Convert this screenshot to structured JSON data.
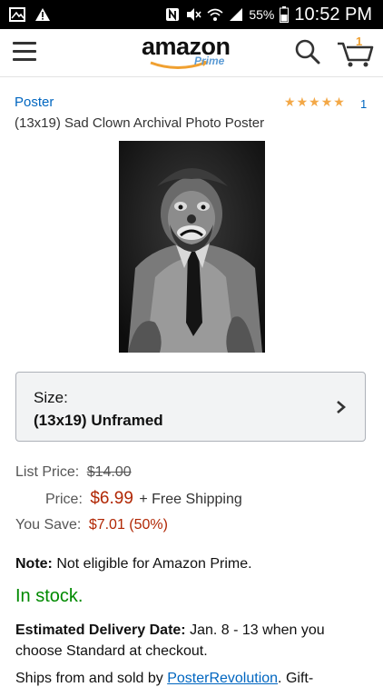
{
  "status_bar": {
    "battery": "55%",
    "time": "10:52 PM"
  },
  "header": {
    "logo_text": "amazon",
    "logo_sub": "Prime",
    "cart_count": "1"
  },
  "product": {
    "brand": "Poster",
    "rating_stars": 5,
    "review_count": "1",
    "title": "(13x19) Sad Clown Archival Photo Poster"
  },
  "size_selector": {
    "label": "Size:",
    "value": "(13x19) Unframed"
  },
  "pricing": {
    "list_price_label": "List Price:",
    "list_price_value": "$14.00",
    "price_label": "Price:",
    "price_value": "$6.99",
    "shipping_text": "+ Free Shipping",
    "you_save_label": "You Save:",
    "you_save_value": "$7.01 (50%)"
  },
  "note": {
    "label": "Note:",
    "text": " Not eligible for Amazon Prime."
  },
  "stock_status": "In stock.",
  "delivery": {
    "label": "Estimated Delivery Date:",
    "text": " Jan. 8 - 13 when you choose Standard at checkout."
  },
  "ships_from": {
    "prefix": "Ships from and sold by ",
    "seller": "PosterRevolution",
    "suffix": ". Gift-"
  },
  "colors": {
    "link": "#0066c0",
    "price_red": "#b12704",
    "in_stock_green": "#008a00",
    "star_orange": "#f3a847"
  }
}
